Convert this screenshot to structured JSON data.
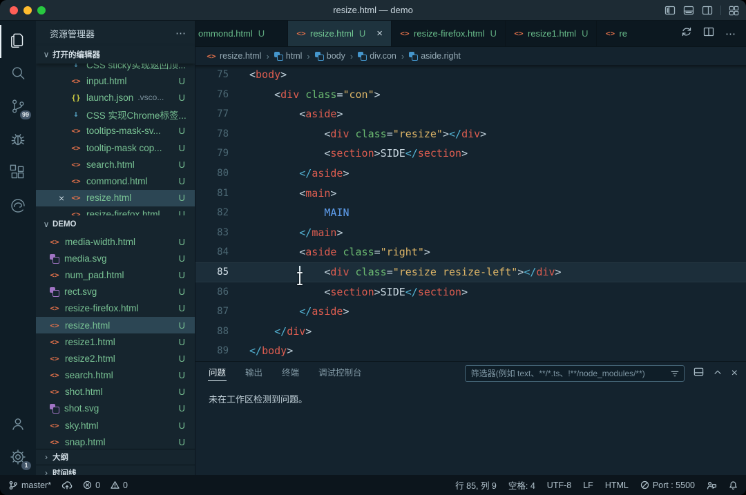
{
  "window": {
    "title": "resize.html — demo"
  },
  "icons": {
    "chevron_down": "∨",
    "chevron_right": "›",
    "more": "⋯",
    "close": "×",
    "html": "<>",
    "json": "{}",
    "arrow": "↓"
  },
  "activity_bar": {
    "scm_badge": "99",
    "settings_badge": "1"
  },
  "sidebar": {
    "header": "资源管理器",
    "sections": {
      "open_editors": "打开的编辑器",
      "folder": "DEMO",
      "outline": "大纲",
      "timeline": "时间线"
    },
    "open_editors": [
      {
        "label": "CSS sticky实现返回顶...",
        "icon": "arrow",
        "badge": ""
      },
      {
        "label": "input.html",
        "icon": "html",
        "badge": "U"
      },
      {
        "label": "launch.json",
        "desc": ".vsco...",
        "icon": "json",
        "badge": "U"
      },
      {
        "label": "CSS 实现Chrome标签...",
        "icon": "arrow",
        "badge": ""
      },
      {
        "label": "tooltips-mask-sv...",
        "icon": "html",
        "badge": "U"
      },
      {
        "label": "tooltip-mask cop...",
        "icon": "html",
        "badge": "U"
      },
      {
        "label": "search.html",
        "icon": "html",
        "badge": "U"
      },
      {
        "label": "commond.html",
        "icon": "html",
        "badge": "U"
      },
      {
        "label": "resize.html",
        "icon": "html",
        "badge": "U",
        "selected": true,
        "closable": true
      },
      {
        "label": "resize-firefox.html",
        "icon": "html",
        "badge": "U"
      }
    ],
    "files": [
      {
        "label": "media-width.html",
        "icon": "html",
        "badge": "U"
      },
      {
        "label": "media.svg",
        "icon": "svg",
        "badge": "U"
      },
      {
        "label": "num_pad.html",
        "icon": "html",
        "badge": "U"
      },
      {
        "label": "rect.svg",
        "icon": "svg",
        "badge": "U"
      },
      {
        "label": "resize-firefox.html",
        "icon": "html",
        "badge": "U"
      },
      {
        "label": "resize.html",
        "icon": "html",
        "badge": "U",
        "selected": true
      },
      {
        "label": "resize1.html",
        "icon": "html",
        "badge": "U"
      },
      {
        "label": "resize2.html",
        "icon": "html",
        "badge": "U"
      },
      {
        "label": "search.html",
        "icon": "html",
        "badge": "U"
      },
      {
        "label": "shot.html",
        "icon": "html",
        "badge": "U"
      },
      {
        "label": "shot.svg",
        "icon": "svg",
        "badge": "U"
      },
      {
        "label": "sky.html",
        "icon": "html",
        "badge": "U"
      },
      {
        "label": "snap.html",
        "icon": "html",
        "badge": "U"
      }
    ]
  },
  "tabs": [
    {
      "label": "ommond.html",
      "badge": "U",
      "cut": "left"
    },
    {
      "label": "resize.html",
      "badge": "U",
      "icon": "html",
      "active": true,
      "closable": true
    },
    {
      "label": "resize-firefox.html",
      "badge": "U",
      "icon": "html"
    },
    {
      "label": "resize1.html",
      "badge": "U",
      "icon": "html"
    },
    {
      "label": "re",
      "badge": "",
      "icon": "html",
      "cut": "right"
    }
  ],
  "breadcrumbs": [
    {
      "label": "resize.html",
      "icon": "html"
    },
    {
      "label": "html",
      "icon": "symbol"
    },
    {
      "label": "body",
      "icon": "symbol"
    },
    {
      "label": "div.con",
      "icon": "symbol"
    },
    {
      "label": "aside.right",
      "icon": "symbol"
    }
  ],
  "editor": {
    "cursor": {
      "line": 85,
      "col": 9
    },
    "lines": [
      {
        "n": 75,
        "i": 0,
        "s": [
          [
            "pu",
            "<"
          ],
          [
            "tg",
            "body"
          ],
          [
            "pu",
            ">"
          ]
        ]
      },
      {
        "n": 76,
        "i": 1,
        "s": [
          [
            "pu",
            "<"
          ],
          [
            "tg",
            "div"
          ],
          [
            "pu",
            " "
          ],
          [
            "at",
            "class"
          ],
          [
            "pu",
            "="
          ],
          [
            "st",
            "\"con\""
          ],
          [
            "pu",
            ">"
          ]
        ]
      },
      {
        "n": 77,
        "i": 2,
        "s": [
          [
            "pu",
            "<"
          ],
          [
            "tg",
            "aside"
          ],
          [
            "pu",
            ">"
          ]
        ]
      },
      {
        "n": 78,
        "i": 3,
        "s": [
          [
            "pu",
            "<"
          ],
          [
            "tg",
            "div"
          ],
          [
            "pu",
            " "
          ],
          [
            "at",
            "class"
          ],
          [
            "pu",
            "="
          ],
          [
            "st",
            "\"resize\""
          ],
          [
            "pu",
            ">"
          ],
          [
            "cl",
            "</"
          ],
          [
            "tg",
            "div"
          ],
          [
            "pu",
            ">"
          ]
        ]
      },
      {
        "n": 79,
        "i": 3,
        "s": [
          [
            "pu",
            "<"
          ],
          [
            "tg",
            "section"
          ],
          [
            "pu",
            ">"
          ],
          [
            "tx",
            "SIDE"
          ],
          [
            "cl",
            "</"
          ],
          [
            "tg",
            "section"
          ],
          [
            "pu",
            ">"
          ]
        ]
      },
      {
        "n": 80,
        "i": 2,
        "s": [
          [
            "cl",
            "</"
          ],
          [
            "tg",
            "aside"
          ],
          [
            "pu",
            ">"
          ]
        ]
      },
      {
        "n": 81,
        "i": 2,
        "s": [
          [
            "pu",
            "<"
          ],
          [
            "tg",
            "main"
          ],
          [
            "pu",
            ">"
          ]
        ]
      },
      {
        "n": 82,
        "i": 3,
        "s": [
          [
            "bl",
            "MAIN"
          ]
        ]
      },
      {
        "n": 83,
        "i": 2,
        "s": [
          [
            "cl",
            "</"
          ],
          [
            "tg",
            "main"
          ],
          [
            "pu",
            ">"
          ]
        ]
      },
      {
        "n": 84,
        "i": 2,
        "s": [
          [
            "pu",
            "<"
          ],
          [
            "tg",
            "aside"
          ],
          [
            "pu",
            " "
          ],
          [
            "at",
            "class"
          ],
          [
            "pu",
            "="
          ],
          [
            "st",
            "\"right\""
          ],
          [
            "pu",
            ">"
          ]
        ]
      },
      {
        "n": 85,
        "i": 3,
        "s": [
          [
            "pu",
            "<"
          ],
          [
            "tg",
            "div"
          ],
          [
            "pu",
            " "
          ],
          [
            "at",
            "class"
          ],
          [
            "pu",
            "="
          ],
          [
            "st",
            "\"resize resize-left\""
          ],
          [
            "pu",
            ">"
          ],
          [
            "cl",
            "</"
          ],
          [
            "tg",
            "div"
          ],
          [
            "pu",
            ">"
          ]
        ]
      },
      {
        "n": 86,
        "i": 3,
        "s": [
          [
            "pu",
            "<"
          ],
          [
            "tg",
            "section"
          ],
          [
            "pu",
            ">"
          ],
          [
            "tx",
            "SIDE"
          ],
          [
            "cl",
            "</"
          ],
          [
            "tg",
            "section"
          ],
          [
            "pu",
            ">"
          ]
        ]
      },
      {
        "n": 87,
        "i": 2,
        "s": [
          [
            "cl",
            "</"
          ],
          [
            "tg",
            "aside"
          ],
          [
            "pu",
            ">"
          ]
        ]
      },
      {
        "n": 88,
        "i": 1,
        "s": [
          [
            "cl",
            "</"
          ],
          [
            "tg",
            "div"
          ],
          [
            "pu",
            ">"
          ]
        ]
      },
      {
        "n": 89,
        "i": 0,
        "s": [
          [
            "cl",
            "</"
          ],
          [
            "tg",
            "body"
          ],
          [
            "pu",
            ">"
          ]
        ]
      }
    ]
  },
  "panel": {
    "tabs": [
      {
        "label": "问题",
        "active": true
      },
      {
        "label": "输出"
      },
      {
        "label": "终端"
      },
      {
        "label": "调试控制台"
      }
    ],
    "filter_placeholder": "筛选器(例如 text、**/*.ts、!**/node_modules/**)",
    "message": "未在工作区检测到问题。"
  },
  "status_bar": {
    "left": [
      {
        "icon": "branch",
        "label": "master*"
      },
      {
        "icon": "cloud-upload",
        "label": ""
      },
      {
        "icon": "error",
        "label": "0"
      },
      {
        "icon": "warning",
        "label": "0"
      }
    ],
    "right": [
      {
        "label": "行 85, 列 9"
      },
      {
        "label": "空格: 4"
      },
      {
        "label": "UTF-8"
      },
      {
        "label": "LF"
      },
      {
        "label": "HTML"
      },
      {
        "icon": "port",
        "label": "Port : 5500"
      },
      {
        "icon": "feedback",
        "label": ""
      },
      {
        "icon": "bell",
        "label": ""
      }
    ]
  }
}
